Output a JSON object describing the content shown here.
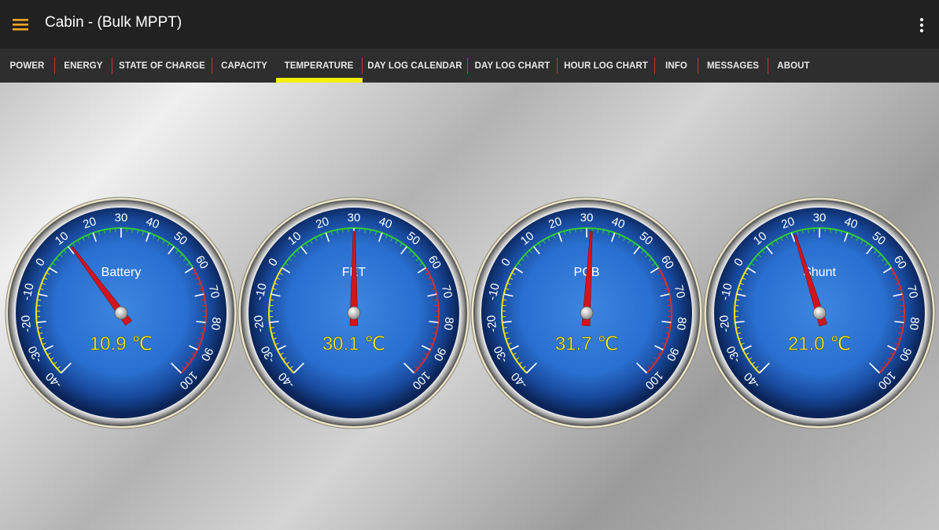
{
  "appbar": {
    "title": "Cabin - (Bulk MPPT)",
    "menu_icon": "hamburger-menu-icon",
    "overflow_icon": "more-vert-icon",
    "accent_color": "#f5a623"
  },
  "tabs": [
    {
      "label": "POWER",
      "active": false
    },
    {
      "label": "ENERGY",
      "active": false
    },
    {
      "label": "STATE OF CHARGE",
      "active": false
    },
    {
      "label": "CAPACITY",
      "active": false
    },
    {
      "label": "TEMPERATURE",
      "active": true
    },
    {
      "label": "DAY LOG CALENDAR",
      "active": false
    },
    {
      "label": "DAY LOG CHART",
      "active": false
    },
    {
      "label": "HOUR LOG CHART",
      "active": false
    },
    {
      "label": "INFO",
      "active": false
    },
    {
      "label": "MESSAGES",
      "active": false
    },
    {
      "label": "ABOUT",
      "active": false
    }
  ],
  "tab_indicator_color": "#f4f00a",
  "tab_divider_color": "#d32f2f",
  "gauges": [
    {
      "label": "Battery",
      "value": 10.9,
      "display": "10.9 ℃"
    },
    {
      "label": "FET",
      "value": 30.1,
      "display": "30.1 ℃"
    },
    {
      "label": "PCB",
      "value": 31.7,
      "display": "31.7 ℃"
    },
    {
      "label": "Shunt",
      "value": 21.0,
      "display": "21.0 ℃"
    }
  ],
  "gauge_scale": {
    "min": -40,
    "max": 100,
    "major_ticks": [
      "-40",
      "-30",
      "-20",
      "-10",
      "0",
      "10",
      "20",
      "30",
      "40",
      "50",
      "60",
      "70",
      "80",
      "90",
      "100"
    ],
    "bands": [
      {
        "from": -40,
        "to": 0,
        "color": "#f2e51c"
      },
      {
        "from": 0,
        "to": 60,
        "color": "#33cc33"
      },
      {
        "from": 60,
        "to": 100,
        "color": "#d32f2f"
      }
    ],
    "value_color": "#f6f22a",
    "needle_color": "#d4141c"
  }
}
